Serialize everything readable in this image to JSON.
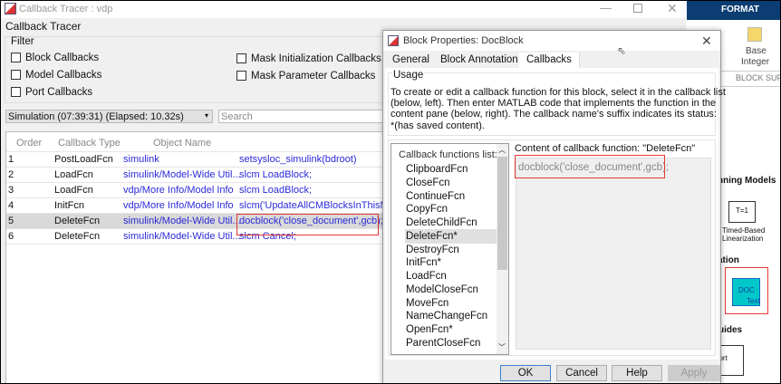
{
  "tracer": {
    "window_title": "Callback Tracer : vdp",
    "heading": "Callback Tracer",
    "filter_label": "Filter",
    "filters": [
      {
        "label": "Block Callbacks",
        "checked": false
      },
      {
        "label": "Model Callbacks",
        "checked": false
      },
      {
        "label": "Port Callbacks",
        "checked": false
      },
      {
        "label": "Mask Initialization Callbacks",
        "checked": false
      },
      {
        "label": "Mask Parameter Callbacks",
        "checked": false
      }
    ],
    "session_select": "Simulation (07:39:31) (Elapsed: 10.32s)",
    "search_placeholder": "Search",
    "columns": [
      "Order",
      "Callback Type",
      "Object Name",
      ""
    ],
    "rows": [
      {
        "order": "1",
        "type": "PostLoadFcn",
        "object": "simulink",
        "code": "setsysloc_simulink(bdroot)"
      },
      {
        "order": "2",
        "type": "LoadFcn",
        "object": "simulink/Model-Wide Util...",
        "code": "slcm LoadBlock;"
      },
      {
        "order": "3",
        "type": "LoadFcn",
        "object": "vdp/More Info/Model Info",
        "code": "slcm LoadBlock;"
      },
      {
        "order": "4",
        "type": "InitFcn",
        "object": "vdp/More Info/Model Info",
        "code": "slcm('UpdateAllCMBlocksInThisMod"
      },
      {
        "order": "5",
        "type": "DeleteFcn",
        "object": "simulink/Model-Wide Util...",
        "code": "docblock('close_document',gcb);"
      },
      {
        "order": "6",
        "type": "DeleteFcn",
        "object": "simulink/Model-Wide Util...",
        "code": "slcm Cancel;"
      }
    ],
    "selected_row": 5
  },
  "dialog": {
    "title": "Block Properties: DocBlock",
    "tabs": [
      "General",
      "Block Annotation",
      "Callbacks"
    ],
    "active_tab": "Callbacks",
    "usage_label": "Usage",
    "usage_lines": [
      "To create or edit a callback function for this block, select it in the callback list",
      "(below, left). Then enter MATLAB code that implements the function in the",
      "content pane (below, right). The callback name's suffix indicates its status:",
      "*(has saved content)."
    ],
    "list_heading": "Callback functions list:",
    "list_items": [
      "ClipboardFcn",
      "CloseFcn",
      "ContinueFcn",
      "CopyFcn",
      "DeleteChildFcn",
      "DeleteFcn*",
      "DestroyFcn",
      "InitFcn*",
      "LoadFcn",
      "ModelCloseFcn",
      "MoveFcn",
      "NameChangeFcn",
      "OpenFcn*",
      "ParentCloseFcn"
    ],
    "selected_item": "DeleteFcn*",
    "content_label": "Content of callback function: \"DeleteFcn\"",
    "content_code": "docblock('close_document',gcb);",
    "buttons": {
      "ok": "OK",
      "cancel": "Cancel",
      "help": "Help",
      "apply": "Apply"
    }
  },
  "ribbon": {
    "tab": "FORMAT",
    "base_integer_1": "Base",
    "base_integer_2": "Integer",
    "section": "BLOCK SUPPO",
    "group1": "nning Models",
    "timed_block": "T=1",
    "timed_label_1": "Timed-Based",
    "timed_label_2": "Linearization",
    "group2": "ation",
    "doc_block_1": "DOC",
    "doc_block_2": "Text",
    "group3": "uides",
    "report": "port"
  },
  "colors": {
    "accent_blue": "#2a2ad8",
    "ribbon_header": "#0b3d73",
    "highlight": "#e53935",
    "doc_block": "#00c8c8"
  }
}
